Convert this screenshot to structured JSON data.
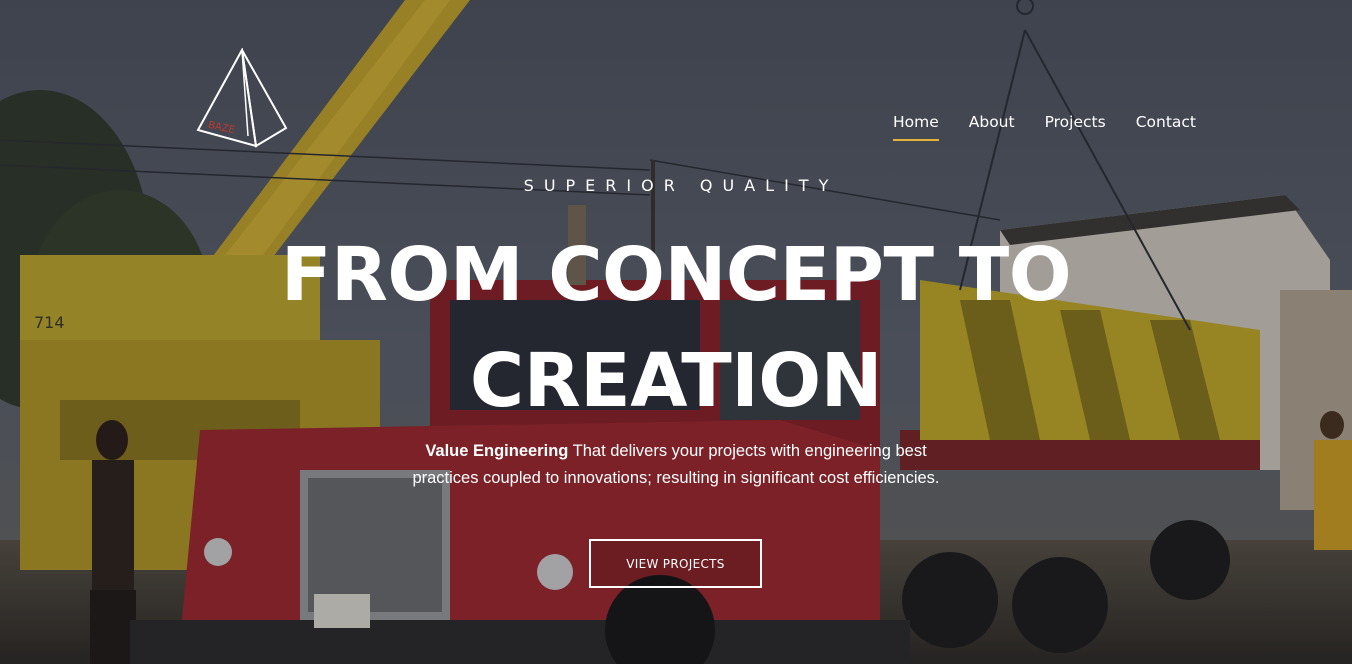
{
  "brand": {
    "logo_text": "BAZE",
    "logo_icon": "pyramid-icon"
  },
  "nav": {
    "items": [
      {
        "label": "Home",
        "active": true
      },
      {
        "label": "About",
        "active": false
      },
      {
        "label": "Projects",
        "active": false
      },
      {
        "label": "Contact",
        "active": false
      }
    ]
  },
  "hero": {
    "kicker": "SUPERIOR QUALITY",
    "headline_line1": "FROM CONCEPT TO",
    "headline_line2": "CREATION",
    "description_lead": "Value Engineering",
    "description_body": " That delivers your projects with engineering best practices coupled to innovations; resulting in significant cost efficiencies.",
    "cta_label": "VIEW PROJECTS",
    "background_image": "mack-truck-with-crane-photo"
  },
  "colors": {
    "accent": "#e2b43a",
    "text": "#ffffff",
    "logo_text": "#c0392b"
  }
}
